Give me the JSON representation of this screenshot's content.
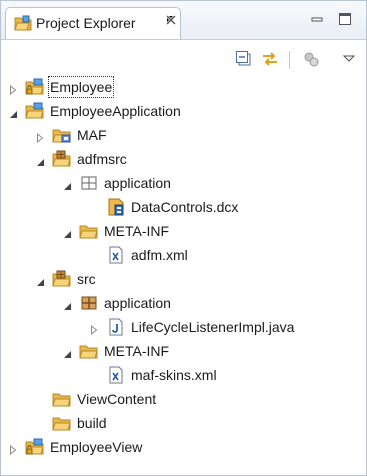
{
  "view": {
    "tab_title": "Project Explorer",
    "tab_icon": "project-explorer-icon",
    "close_icon": "close-icon",
    "minimize_icon": "minimize-icon",
    "maximize_icon": "maximize-icon"
  },
  "toolbar": {
    "buttons": [
      {
        "name": "collapse-all-icon"
      },
      {
        "name": "link-with-editor-icon"
      },
      {
        "name": "focus-on-working-set-icon"
      },
      {
        "name": "view-menu-icon"
      }
    ]
  },
  "tree": [
    {
      "label": "Employee",
      "icon": "project-lock-icon",
      "level": 0,
      "expand": "collapsed",
      "selected": true
    },
    {
      "label": "EmployeeApplication",
      "icon": "open-project-folder-icon",
      "level": 0,
      "expand": "expanded"
    },
    {
      "label": "MAF",
      "icon": "maf-folder-icon",
      "level": 1,
      "expand": "collapsed"
    },
    {
      "label": "adfmsrc",
      "icon": "source-folder-icon",
      "level": 1,
      "expand": "expanded"
    },
    {
      "label": "application",
      "icon": "package-outline-icon",
      "level": 2,
      "expand": "expanded"
    },
    {
      "label": "DataControls.dcx",
      "icon": "datacontrols-file-icon",
      "level": 3,
      "expand": "none"
    },
    {
      "label": "META-INF",
      "icon": "open-folder-icon",
      "level": 2,
      "expand": "expanded"
    },
    {
      "label": "adfm.xml",
      "icon": "xml-file-icon",
      "level": 3,
      "expand": "none"
    },
    {
      "label": "src",
      "icon": "source-folder-icon",
      "level": 1,
      "expand": "expanded"
    },
    {
      "label": "application",
      "icon": "package-icon",
      "level": 2,
      "expand": "expanded"
    },
    {
      "label": "LifeCycleListenerImpl.java",
      "icon": "java-file-icon",
      "level": 3,
      "expand": "collapsed"
    },
    {
      "label": "META-INF",
      "icon": "open-folder-icon",
      "level": 2,
      "expand": "expanded"
    },
    {
      "label": "maf-skins.xml",
      "icon": "xml-file-icon",
      "level": 3,
      "expand": "none"
    },
    {
      "label": "ViewContent",
      "icon": "open-folder-icon",
      "level": 1,
      "expand": "none"
    },
    {
      "label": "build",
      "icon": "open-folder-icon",
      "level": 1,
      "expand": "none"
    },
    {
      "label": "EmployeeView",
      "icon": "project-lock-icon",
      "level": 0,
      "expand": "collapsed"
    }
  ],
  "colors": {
    "folder": "#e8b64a",
    "folder_dark": "#b98a25",
    "project_blue": "#3b7fd4",
    "package_brown": "#8a5a2b",
    "java_blue": "#2a5aa8"
  }
}
